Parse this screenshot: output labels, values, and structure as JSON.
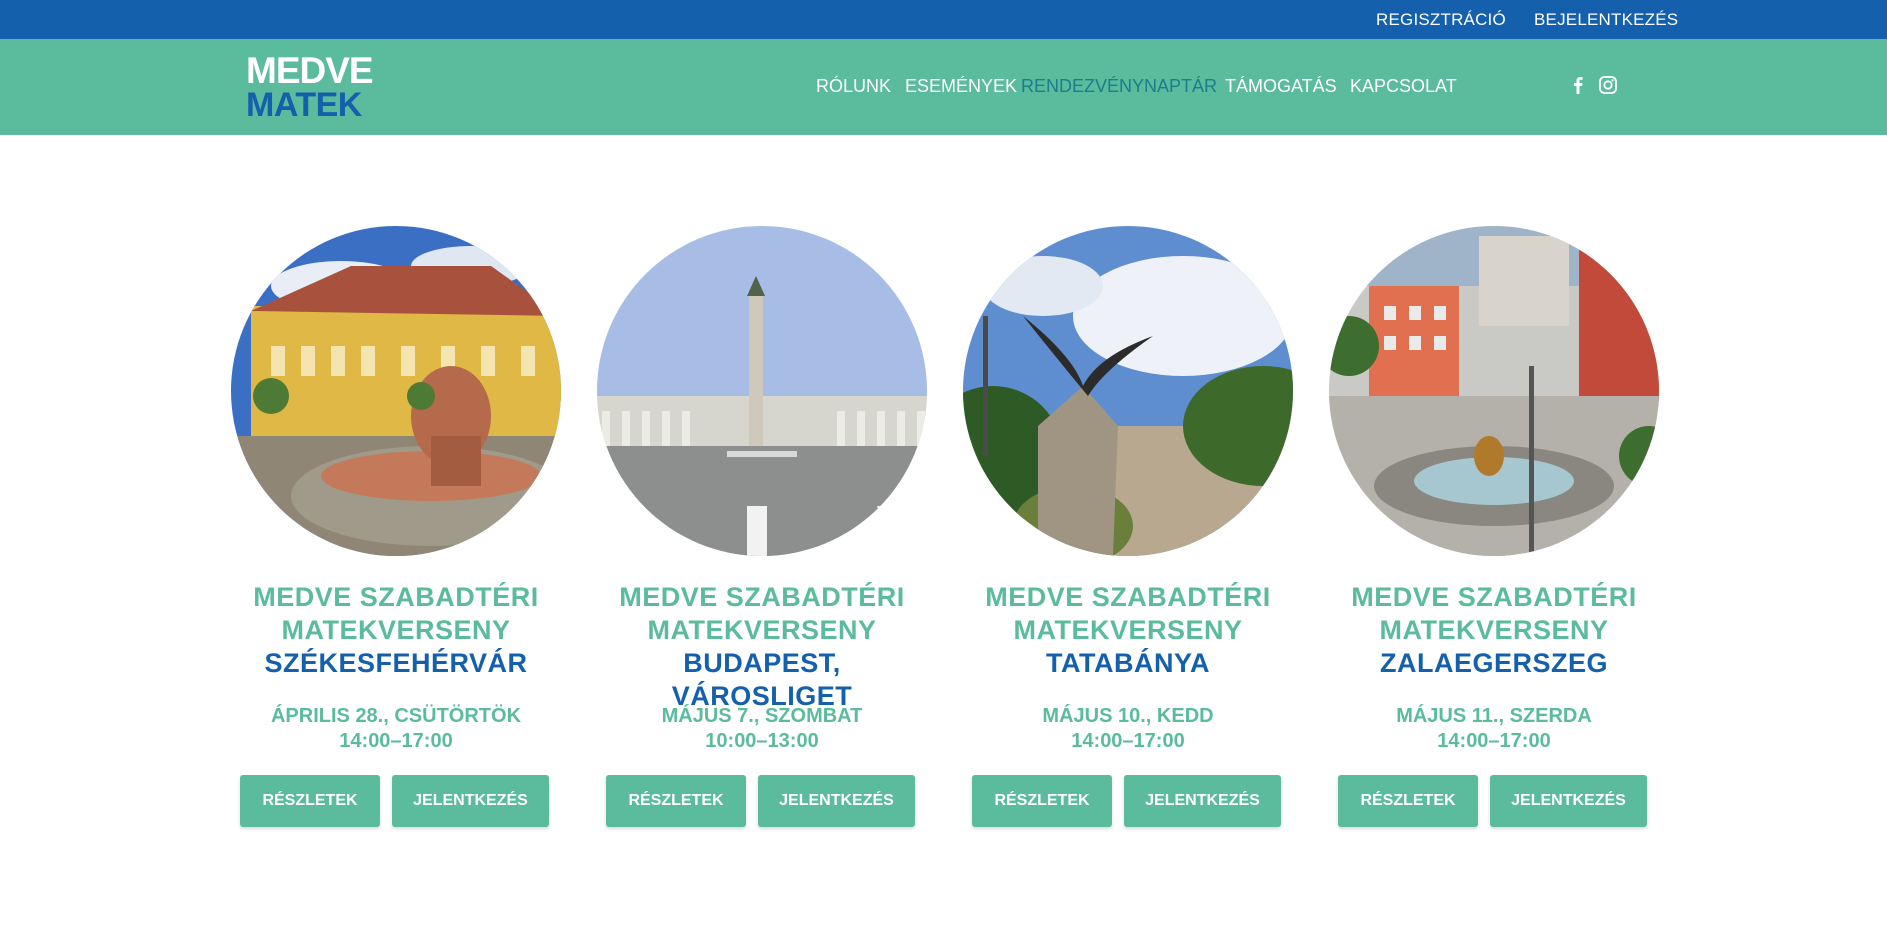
{
  "topbar": {
    "register": "REGISZTRÁCIÓ",
    "login": "BEJELENTKEZÉS"
  },
  "logo": {
    "line1": "MEDVE",
    "line2": "MATEK"
  },
  "nav": {
    "items": [
      {
        "label": "RÓLUNK"
      },
      {
        "label": "ESEMÉNYEK"
      },
      {
        "label": "RENDEZVÉNYNAPTÁR"
      },
      {
        "label": "TÁMOGATÁS"
      },
      {
        "label": "KAPCSOLAT"
      }
    ],
    "social": [
      "facebook-icon",
      "instagram-icon"
    ]
  },
  "colors": {
    "blue": "#1460ac",
    "green": "#5bbb9d",
    "active": "#1a7f8c"
  },
  "events": [
    {
      "title1": "MEDVE SZABADTÉRI",
      "title2": "MATEKVERSENY",
      "city": "SZÉKESFEHÉRVÁR",
      "date": "ÁPRILIS 28., CSÜTÖRTÖK",
      "time": "14:00–17:00",
      "details": "RÉSZLETEK",
      "apply": "JELENTKEZÉS"
    },
    {
      "title1": "MEDVE SZABADTÉRI",
      "title2": "MATEKVERSENY",
      "city": "BUDAPEST, VÁROSLIGET",
      "date": "MÁJUS 7., SZOMBAT",
      "time": "10:00–13:00",
      "details": "RÉSZLETEK",
      "apply": "JELENTKEZÉS"
    },
    {
      "title1": "MEDVE SZABADTÉRI",
      "title2": "MATEKVERSENY",
      "city": "TATABÁNYA",
      "date": "MÁJUS 10., KEDD",
      "time": "14:00–17:00",
      "details": "RÉSZLETEK",
      "apply": "JELENTKEZÉS"
    },
    {
      "title1": "MEDVE SZABADTÉRI",
      "title2": "MATEKVERSENY",
      "city": "ZALAEGERSZEG",
      "date": "MÁJUS 11., SZERDA",
      "time": "14:00–17:00",
      "details": "RÉSZLETEK",
      "apply": "JELENTKEZÉS"
    }
  ]
}
